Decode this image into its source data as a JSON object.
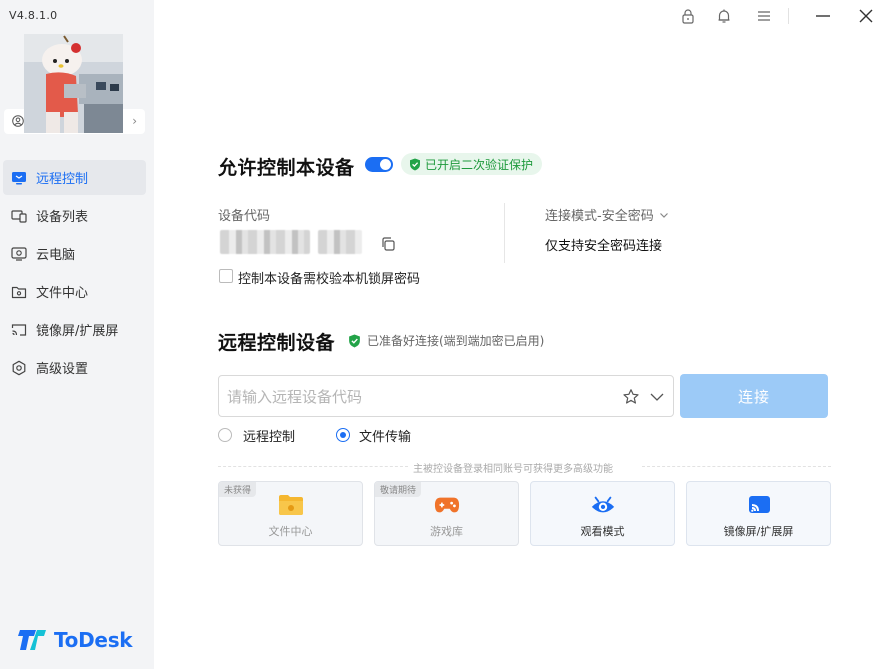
{
  "app": {
    "version": "V4.8.1.0",
    "logo_text": "ToDesk",
    "brand_color": "#1b6ef3"
  },
  "topbar": {
    "icons": [
      "lock-icon",
      "bell-icon",
      "menu-icon",
      "minimize-icon",
      "close-icon"
    ]
  },
  "sidebar": {
    "items": [
      {
        "label": "远程控制",
        "icon": "remote-control-icon",
        "active": true
      },
      {
        "label": "设备列表",
        "icon": "device-list-icon",
        "active": false
      },
      {
        "label": "云电脑",
        "icon": "cloud-pc-icon",
        "active": false
      },
      {
        "label": "文件中心",
        "icon": "folder-icon",
        "active": false
      },
      {
        "label": "镜像屏/扩展屏",
        "icon": "screen-cast-icon",
        "active": false
      },
      {
        "label": "高级设置",
        "icon": "gear-icon",
        "active": false
      }
    ]
  },
  "allow_control": {
    "title": "允许控制本设备",
    "toggle_on": true,
    "badge": "已开启二次验证保护",
    "device_code_label": "设备代码",
    "connection_mode_label": "连接模式-安全密码",
    "connection_mode_value": "仅支持安全密码连接",
    "lock_screen_checkbox_label": "控制本设备需校验本机锁屏密码",
    "lock_screen_checked": false
  },
  "remote_control": {
    "title": "远程控制设备",
    "status": "已准备好连接(端到端加密已启用)",
    "input_placeholder": "请输入远程设备代码",
    "connect_label": "连接",
    "options": [
      {
        "label": "远程控制",
        "checked": false
      },
      {
        "label": "文件传输",
        "checked": true
      }
    ],
    "hint": "主被控设备登录相同账号可获得更多高级功能",
    "features": [
      {
        "label": "文件中心",
        "tag": "未获得",
        "icon": "folder-icon",
        "enabled": false
      },
      {
        "label": "游戏库",
        "tag": "敬请期待",
        "icon": "gamepad-icon",
        "enabled": false
      },
      {
        "label": "观看模式",
        "tag": "",
        "icon": "eye-icon",
        "enabled": true
      },
      {
        "label": "镜像屏/扩展屏",
        "tag": "",
        "icon": "screen-cast-icon",
        "enabled": true
      }
    ]
  }
}
